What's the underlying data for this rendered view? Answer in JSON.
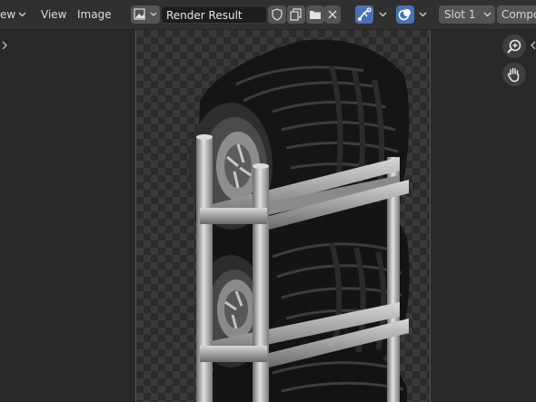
{
  "header": {
    "view_menu_partial": "ew",
    "menu_view": "View",
    "menu_image": "Image",
    "image_name": "Render Result",
    "slot": "Slot 1",
    "pass_partial": "Compo"
  },
  "icons": {
    "view_dropdown": "chevron-down-icon",
    "image_browse": "image-icon",
    "fake_user": "shield-icon",
    "duplicate": "duplicate-icon",
    "open": "folder-icon",
    "unlink": "close-icon",
    "gizmo": "gizmo-icon",
    "overlay": "overlay-icon",
    "zoom": "zoom-in-icon",
    "pan": "hand-icon",
    "sidebar_left": "chevron-right-icon",
    "sidebar_right": "chevron-left-icon"
  },
  "colors": {
    "header_bg": "#303030",
    "viewport_bg": "#282828",
    "accent": "#4772b3"
  }
}
